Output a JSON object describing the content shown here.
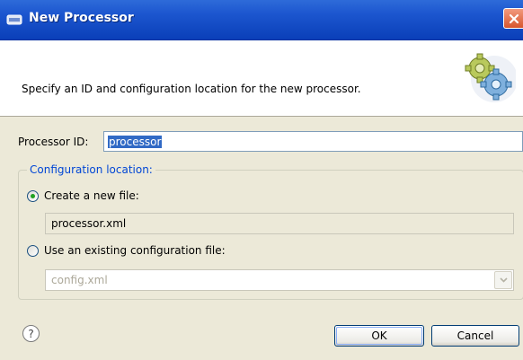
{
  "window": {
    "title": "New Processor"
  },
  "header": {
    "message": "Specify an ID and configuration location for the new processor."
  },
  "processor_id": {
    "label": "Processor ID:",
    "value": "processor"
  },
  "config_group": {
    "title": "Configuration location:",
    "new_file": {
      "label": "Create a new file:",
      "selected": true,
      "value": "processor.xml"
    },
    "existing_file": {
      "label": "Use an existing configuration file:",
      "selected": false,
      "value": "config.xml"
    }
  },
  "buttons": {
    "help": "?",
    "ok": "OK",
    "cancel": "Cancel"
  },
  "colors": {
    "titlebar": "#1c56cf",
    "group_title": "#0046d5",
    "selection": "#316ac5"
  },
  "icons": {
    "app": "app-icon",
    "close": "close-icon",
    "banner": "gears-icon",
    "help": "help-icon",
    "dropdown": "chevron-down-icon"
  }
}
